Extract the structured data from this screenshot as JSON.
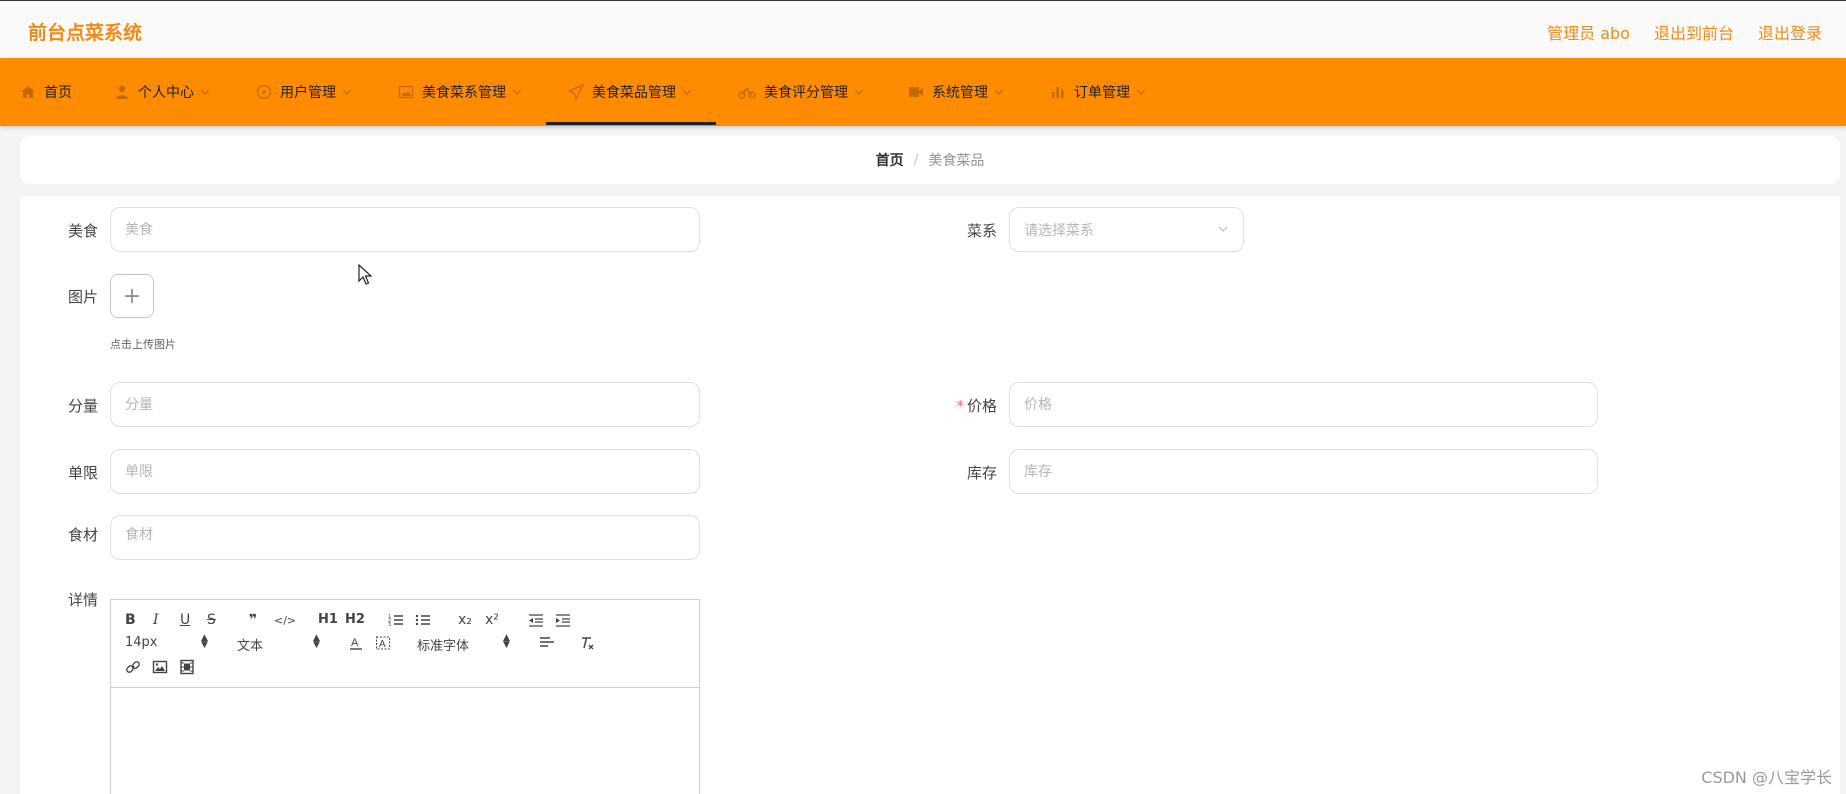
{
  "header": {
    "brand": "前台点菜系统",
    "links": [
      "管理员 abo",
      "退出到前台",
      "退出登录"
    ]
  },
  "nav": {
    "items": [
      {
        "label": "首页",
        "icon": "home-icon",
        "has_caret": false
      },
      {
        "label": "个人中心",
        "icon": "user-icon",
        "has_caret": true
      },
      {
        "label": "用户管理",
        "icon": "compass-icon",
        "has_caret": true
      },
      {
        "label": "美食菜系管理",
        "icon": "picture-icon",
        "has_caret": true
      },
      {
        "label": "美食菜品管理",
        "icon": "paper-plane-icon",
        "has_caret": true,
        "active": true
      },
      {
        "label": "美食评分管理",
        "icon": "bike-icon",
        "has_caret": true
      },
      {
        "label": "系统管理",
        "icon": "video-icon",
        "has_caret": true
      },
      {
        "label": "订单管理",
        "icon": "bar-chart-icon",
        "has_caret": true
      }
    ]
  },
  "breadcrumb": {
    "home": "首页",
    "separator": "/",
    "current": "美食菜品"
  },
  "form": {
    "food_label": "美食",
    "food_placeholder": "美食",
    "cuisine_label": "菜系",
    "cuisine_placeholder": "请选择菜系",
    "image_label": "图片",
    "image_upload_symbol": "+",
    "image_tip": "点击上传图片",
    "portion_label": "分量",
    "portion_placeholder": "分量",
    "price_label": "价格",
    "price_required": "*",
    "price_placeholder": "价格",
    "limit_label": "单限",
    "limit_placeholder": "单限",
    "stock_label": "库存",
    "stock_placeholder": "库存",
    "ingredients_label": "食材",
    "ingredients_placeholder": "食材",
    "detail_label": "详情"
  },
  "editor_toolbar": {
    "row1": [
      "B",
      "I",
      "U",
      "S",
      "❞",
      "</>",
      "H1",
      "H2",
      "ordered-list",
      "bullet-list",
      "x₂",
      "x²",
      "outdent",
      "indent"
    ],
    "size_value": "14px",
    "header_value": "文本",
    "font_value": "标准字体",
    "row3": [
      "link-icon",
      "image-icon",
      "video-icon"
    ]
  },
  "watermark": "CSDN @八宝学长",
  "colors": {
    "accent": "#ff8c00",
    "brand_text": "#f28a16"
  }
}
